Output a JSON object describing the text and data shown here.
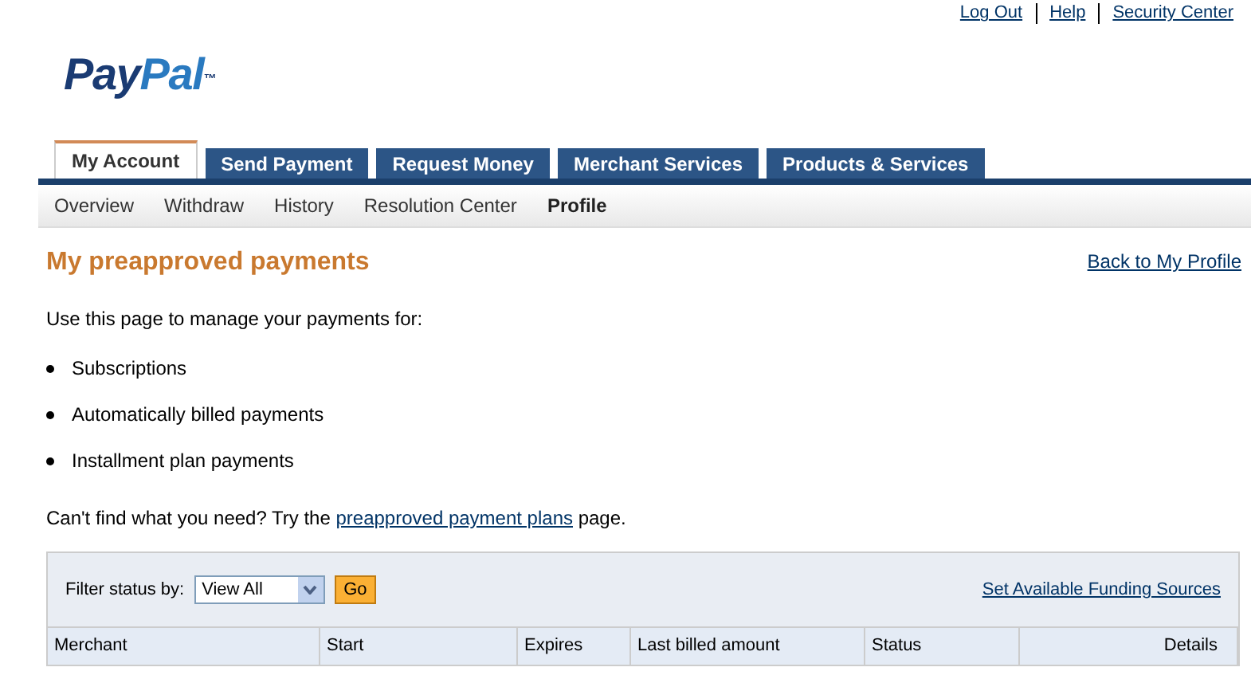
{
  "top_links": [
    "Log Out",
    "Help",
    "Security Center"
  ],
  "logo": {
    "part_1": "Pay",
    "part_2": "Pal",
    "mark": "™"
  },
  "tabs": [
    {
      "label": "My Account",
      "selected": true
    },
    {
      "label": "Send Payment",
      "selected": false
    },
    {
      "label": "Request Money",
      "selected": false
    },
    {
      "label": "Merchant Services",
      "selected": false
    },
    {
      "label": "Products & Services",
      "selected": false
    }
  ],
  "subnav": [
    {
      "label": "Overview",
      "selected": false
    },
    {
      "label": "Withdraw",
      "selected": false
    },
    {
      "label": "History",
      "selected": false
    },
    {
      "label": "Resolution Center",
      "selected": false
    },
    {
      "label": "Profile",
      "selected": true
    }
  ],
  "heading": "My preapproved payments",
  "back_link": "Back to My Profile",
  "intro": "Use this page to manage your payments for:",
  "bullets": [
    "Subscriptions",
    "Automatically billed payments",
    "Installment plan payments"
  ],
  "help_text": {
    "before": "Can't find what you need? Try the ",
    "link": "preapproved payment plans",
    "after": " page."
  },
  "filter": {
    "label": "Filter status by:",
    "value": "View All",
    "button": "Go",
    "link": "Set Available Funding Sources"
  },
  "table": {
    "columns": [
      "Merchant",
      "Start",
      "Expires",
      "Last billed amount",
      "Status",
      "Details"
    ]
  }
}
